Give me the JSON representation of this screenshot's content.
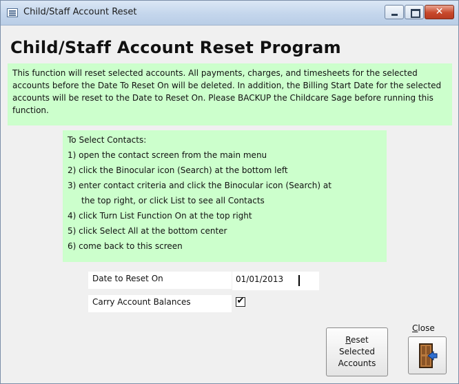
{
  "window": {
    "title": "Child/Staff Account Reset",
    "close_glyph": "✕"
  },
  "page": {
    "heading": "Child/Staff Account Reset Program",
    "intro": "This function will reset selected accounts. All payments, charges, and timesheets for the selected accounts before the Date To Reset On will be deleted. In addition, the Billing Start Date for the selected accounts will be reset to the Date to Reset On. Please BACKUP the Childcare Sage before running this function."
  },
  "instructions": {
    "title": "To Select Contacts:",
    "steps": [
      "1) open the contact screen from the main menu",
      "2) click the Binocular icon (Search) at the bottom left",
      "3) enter contact criteria and click the Binocular icon (Search) at",
      "the top right, or click List to see all Contacts",
      "4) click Turn List Function On at the top right",
      "5) click Select All at the bottom center",
      "6) come back to this screen"
    ]
  },
  "form": {
    "date_label": "Date to Reset On",
    "date_value": "01/01/2013",
    "carry_label": "Carry Account Balances",
    "carry_checked_glyph": "✔"
  },
  "buttons": {
    "reset_access_key": "R",
    "reset_line1_rest": "eset",
    "reset_line2": "Selected",
    "reset_line3": "Accounts",
    "close_access_key": "C",
    "close_label_rest": "lose"
  },
  "icons": {
    "app": "form-icon",
    "close": "exit-door-icon"
  }
}
